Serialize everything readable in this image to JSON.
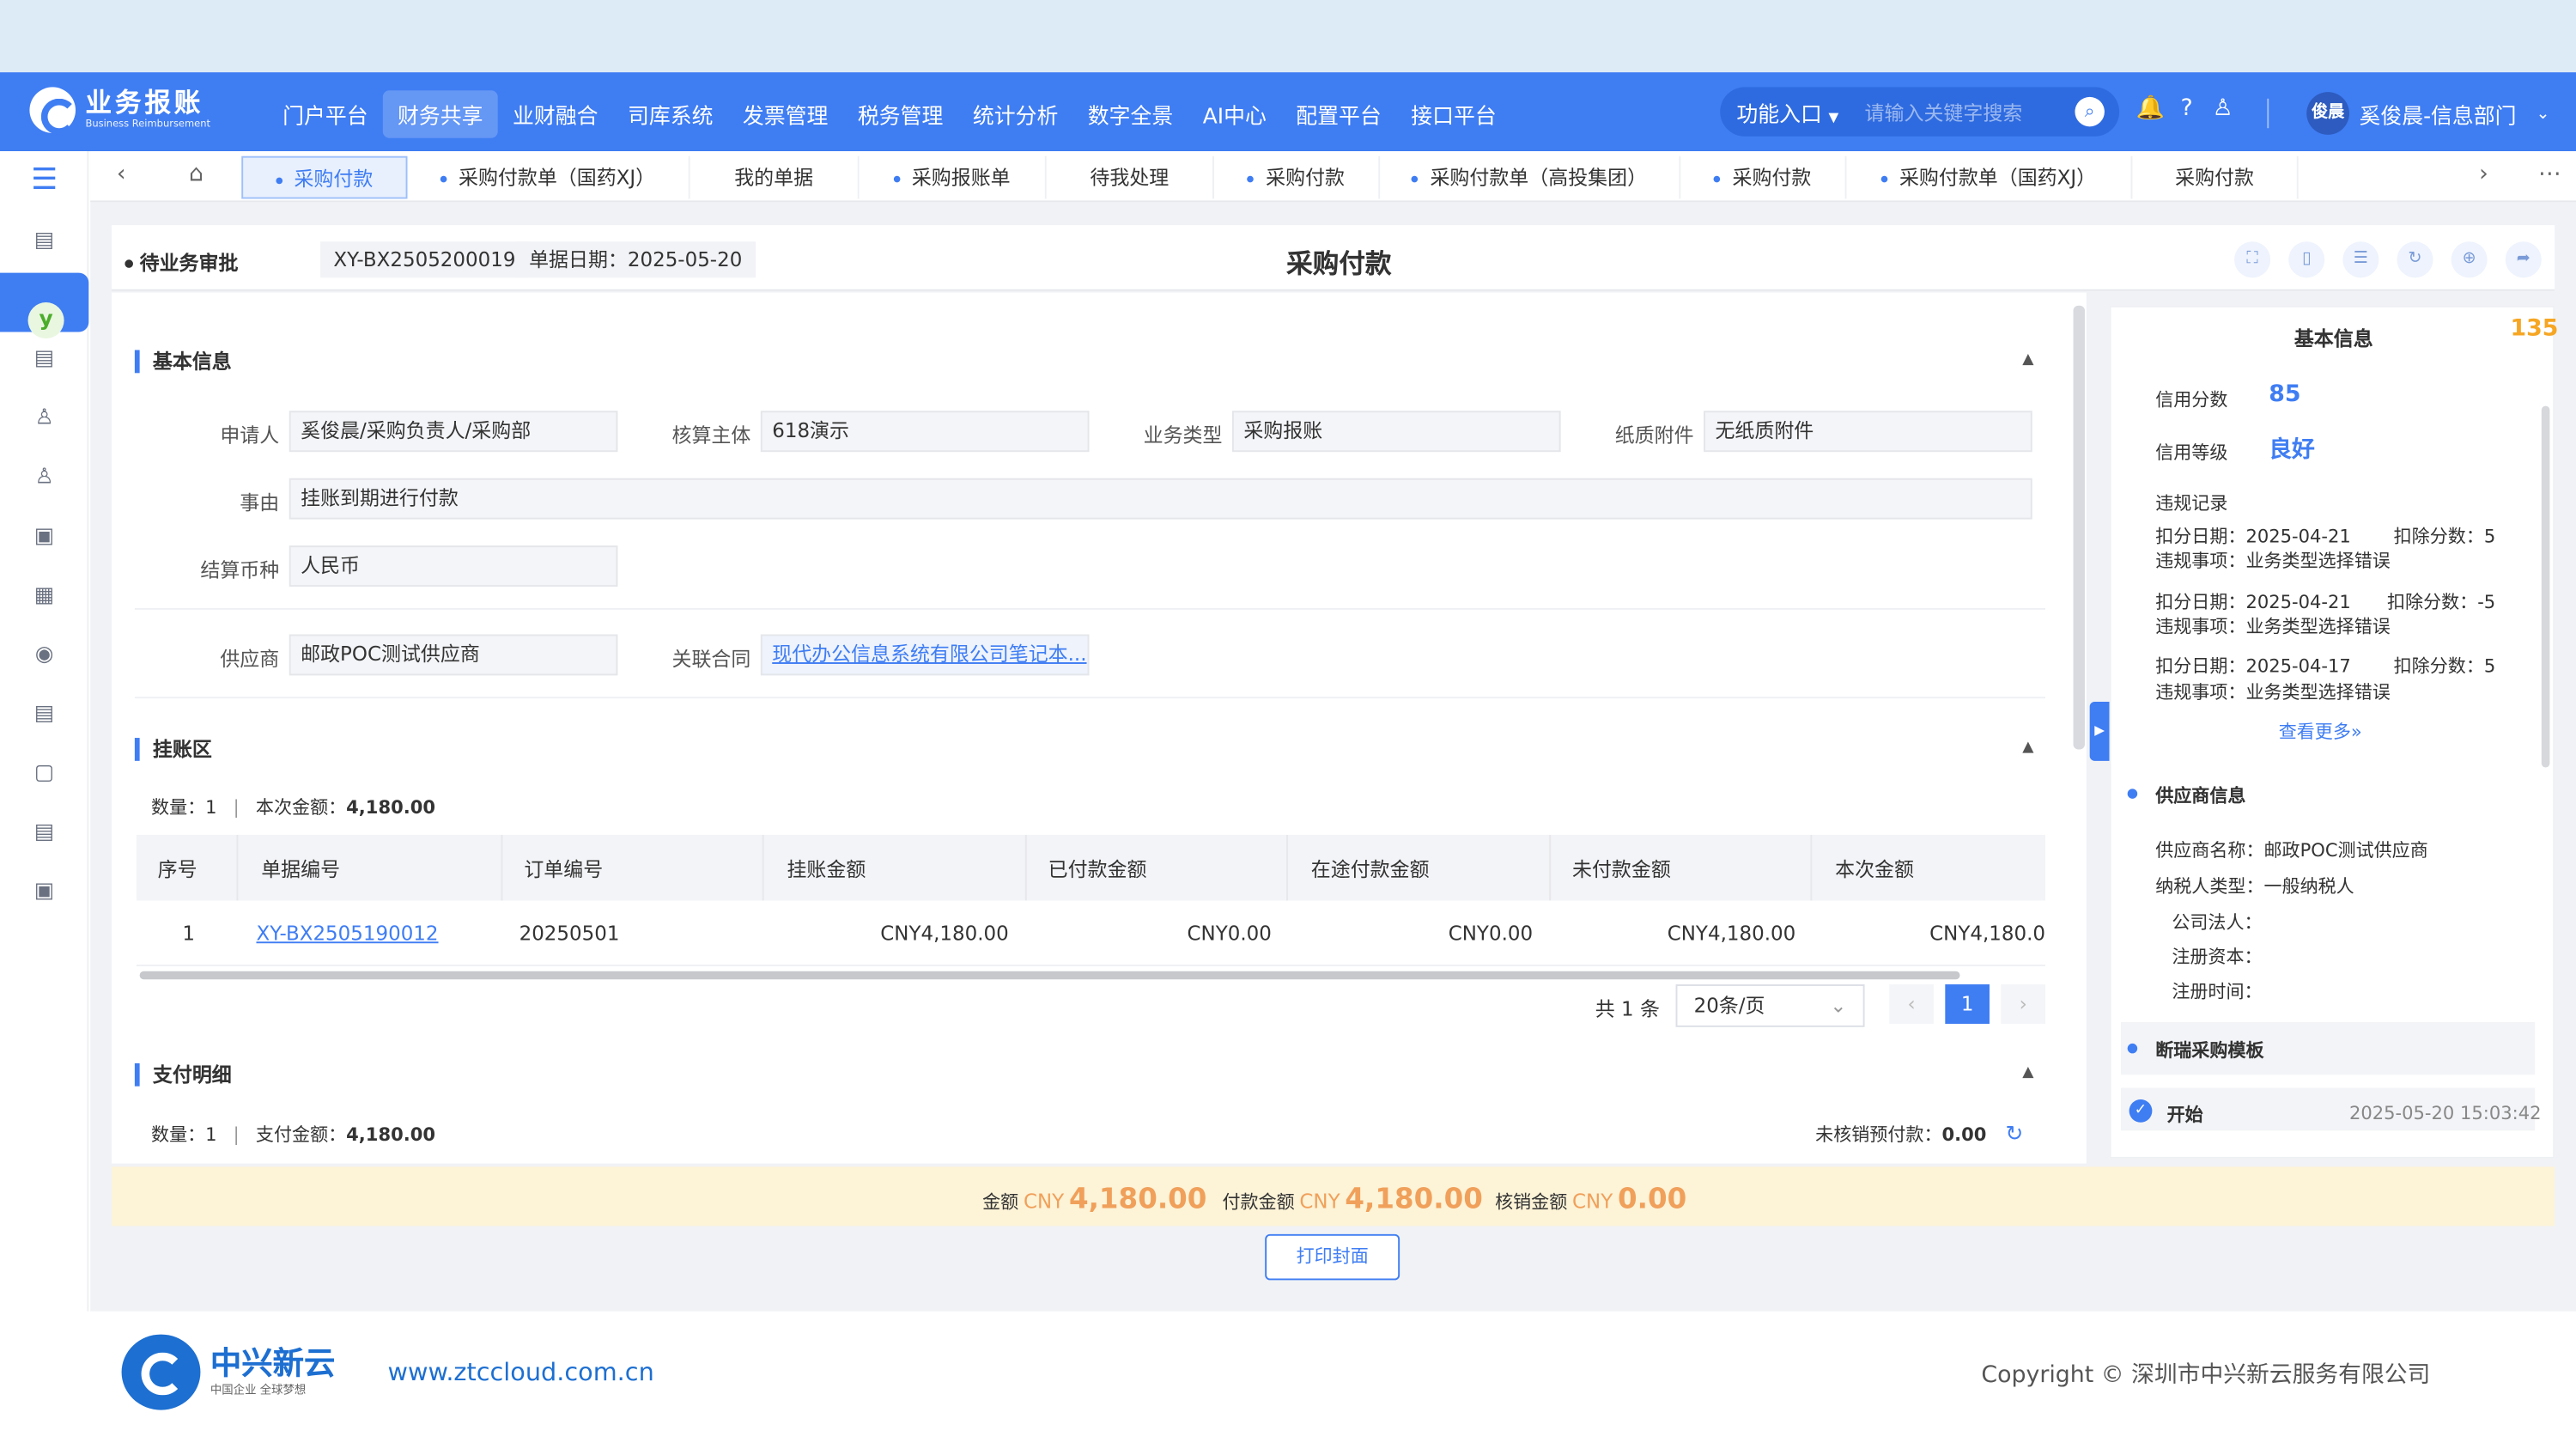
{
  "app": {
    "title": "业务报账",
    "subtitle": "Business Reimbursement"
  },
  "topnav": {
    "menu": [
      "门户平台",
      "财务共享",
      "业财融合",
      "司库系统",
      "发票管理",
      "税务管理",
      "统计分析",
      "数字全景",
      "AI中心",
      "配置平台",
      "接口平台"
    ],
    "active_menu": "财务共享",
    "func_entry": "功能入口",
    "search_placeholder": "请输入关键字搜索",
    "user_avatar": "俊晨",
    "user_name": "奚俊晨-信息部门"
  },
  "tabs": [
    "采购付款",
    "采购付款单（国药XJ）",
    "我的单据",
    "采购报账单",
    "待我处理",
    "采购付款",
    "采购付款单（高投集团）",
    "采购付款",
    "采购付款单（国药XJ）",
    "采购付款"
  ],
  "header": {
    "status": "待业务审批",
    "doc_no": "XY-BX2505200019",
    "doc_date": "单据日期：2025-05-20",
    "title": "采购付款"
  },
  "basic": {
    "section_title": "基本信息",
    "applicant_label": "申请人",
    "applicant": "奚俊晨/采购负责人/采购部",
    "entity_label": "核算主体",
    "entity": "618演示",
    "biz_type_label": "业务类型",
    "biz_type": "采购报账",
    "paper_label": "纸质附件",
    "paper": "无纸质附件",
    "reason_label": "事由",
    "reason": "挂账到期进行付款",
    "currency_label": "结算币种",
    "currency": "人民币",
    "supplier_label": "供应商",
    "supplier": "邮政POC测试供应商",
    "contract_label": "关联合同",
    "contract": "现代办公信息系统有限公司笔记本..."
  },
  "ledger": {
    "section_title": "挂账区",
    "count_label": "数量：",
    "count": "1",
    "amount_label": "本次金额：",
    "amount": "4,180.00",
    "columns": [
      "序号",
      "单据编号",
      "订单编号",
      "挂账金额",
      "已付款金额",
      "在途付款金额",
      "未付款金额",
      "本次金额"
    ],
    "rows": [
      {
        "idx": "1",
        "doc": "XY-BX2505190012",
        "order": "20250501",
        "hang": "CNY4,180.00",
        "paid": "CNY0.00",
        "transit": "CNY0.00",
        "unpaid": "CNY4,180.00",
        "current": "CNY4,180.0"
      }
    ],
    "total": "共 1 条",
    "page_size": "20条/页",
    "page": "1"
  },
  "payment": {
    "section_title": "支付明细",
    "count_label": "数量：",
    "count": "1",
    "amount_label": "支付金额：",
    "amount": "4,180.00",
    "prepay_label": "未核销预付款：",
    "prepay": "0.00"
  },
  "summary": {
    "amount_label": "金额",
    "amount_cny": "CNY",
    "amount": "4,180.00",
    "pay_label": "付款金额",
    "pay_cny": "CNY",
    "pay": "4,180.00",
    "writeoff_label": "核销金额",
    "writeoff_cny": "CNY",
    "writeoff": "0.00",
    "print_button": "打印封面"
  },
  "right": {
    "title": "基本信息",
    "badge": "135",
    "credit_score_label": "信用分数",
    "credit_score": "85",
    "credit_level_label": "信用等级",
    "credit_level": "良好",
    "violation_title": "违规记录",
    "violations": [
      {
        "date": "扣分日期：2025-04-21",
        "score": "扣除分数：5",
        "item": "违规事项：业务类型选择错误"
      },
      {
        "date": "扣分日期：2025-04-21",
        "score": "扣除分数：-5",
        "item": "违规事项：业务类型选择错误"
      },
      {
        "date": "扣分日期：2025-04-17",
        "score": "扣除分数：5",
        "item": "违规事项：业务类型选择错误"
      }
    ],
    "more": "查看更多",
    "supplier_title": "供应商信息",
    "supplier_name": "供应商名称：邮政POC测试供应商",
    "taxpayer": "纳税人类型：一般纳税人",
    "legal": "公司法人：",
    "capital": "注册资本：",
    "reg_time": "注册时间：",
    "template_title": "断瑞采购模板",
    "start_label": "开始",
    "start_time": "2025-05-20 15:03:42"
  },
  "footer": {
    "company": "中兴新云",
    "slogan": "中国企业 全球梦想",
    "url": "www.ztccloud.com.cn",
    "copyright": "Copyright © 深圳市中兴新云服务有限公司"
  },
  "colors": {
    "primary": "#3f7df3",
    "accent": "#f0a05a",
    "summary_bg": "#fdf3d7"
  }
}
